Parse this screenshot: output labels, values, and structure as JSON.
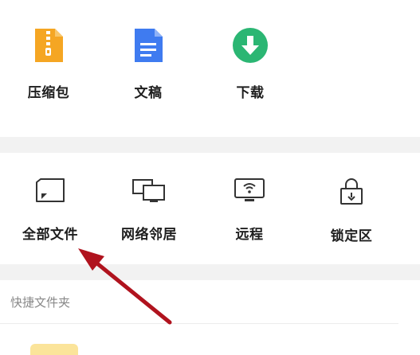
{
  "categories": [
    {
      "label": "压缩包",
      "icon": "zip-archive-icon",
      "color": "#F5A623"
    },
    {
      "label": "文稿",
      "icon": "document-icon",
      "color": "#3F7BF0"
    },
    {
      "label": "下载",
      "icon": "download-icon",
      "color": "#2BB673"
    }
  ],
  "locations": [
    {
      "label": "全部文件",
      "icon": "all-files-icon"
    },
    {
      "label": "网络邻居",
      "icon": "network-neighborhood-icon"
    },
    {
      "label": "远程",
      "icon": "remote-icon"
    },
    {
      "label": "锁定区",
      "icon": "lock-zone-icon"
    }
  ],
  "quick_folders": {
    "title": "快捷文件夹"
  },
  "annotation": {
    "arrow_color": "#B0131E",
    "points_to": "全部文件"
  }
}
